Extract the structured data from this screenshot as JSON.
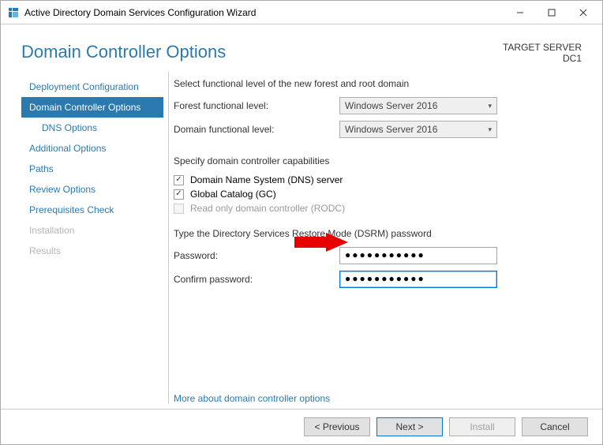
{
  "window": {
    "title": "Active Directory Domain Services Configuration Wizard"
  },
  "header": {
    "page_title": "Domain Controller Options",
    "target_label": "TARGET SERVER",
    "target_name": "DC1"
  },
  "sidebar": {
    "items": [
      {
        "label": "Deployment Configuration"
      },
      {
        "label": "Domain Controller Options"
      },
      {
        "label": "DNS Options"
      },
      {
        "label": "Additional Options"
      },
      {
        "label": "Paths"
      },
      {
        "label": "Review Options"
      },
      {
        "label": "Prerequisites Check"
      },
      {
        "label": "Installation"
      },
      {
        "label": "Results"
      }
    ]
  },
  "main": {
    "func_level_heading": "Select functional level of the new forest and root domain",
    "forest_level_label": "Forest functional level:",
    "forest_level_value": "Windows Server 2016",
    "domain_level_label": "Domain functional level:",
    "domain_level_value": "Windows Server 2016",
    "capabilities_heading": "Specify domain controller capabilities",
    "cb_dns": "Domain Name System (DNS) server",
    "cb_gc": "Global Catalog (GC)",
    "cb_rodc": "Read only domain controller (RODC)",
    "dsrm_heading": "Type the Directory Services Restore Mode (DSRM) password",
    "password_label": "Password:",
    "password_value": "●●●●●●●●●●●",
    "confirm_label": "Confirm password:",
    "confirm_value": "●●●●●●●●●●●",
    "more_link": "More about domain controller options"
  },
  "footer": {
    "previous": "< Previous",
    "next": "Next >",
    "install": "Install",
    "cancel": "Cancel"
  }
}
